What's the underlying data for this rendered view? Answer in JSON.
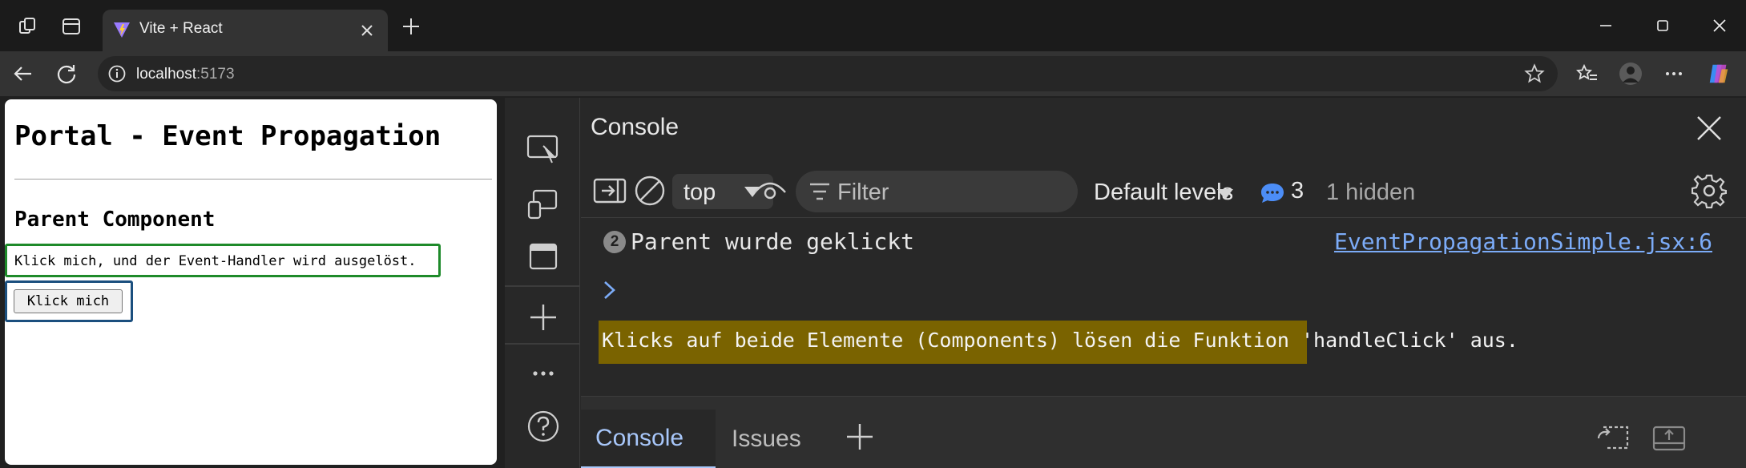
{
  "browser": {
    "tab_title": "Vite + React",
    "url_host": "localhost",
    "url_port": ":5173"
  },
  "page": {
    "heading": "Portal - Event Propagation",
    "subheading": "Parent Component",
    "message": "Klick mich, und der Event-Handler wird ausgelöst.",
    "button_label": "Klick mich",
    "colors": {
      "green_border": "#1e8a2a",
      "blue_border": "#1b4f7e"
    }
  },
  "devtools": {
    "panel_title": "Console",
    "context": "top",
    "filter_placeholder": "Filter",
    "levels": "Default levels",
    "message_count": "3",
    "hidden": "1 hidden",
    "log": {
      "badge": "2",
      "text": "Parent wurde geklickt",
      "source": "EventPropagationSimple.jsx:6"
    },
    "highlight_text": "Klicks auf beide Elemente (Components) lösen die Funktion 'handleClick' aus.",
    "drawer_tabs": [
      "Console",
      "Issues"
    ]
  }
}
